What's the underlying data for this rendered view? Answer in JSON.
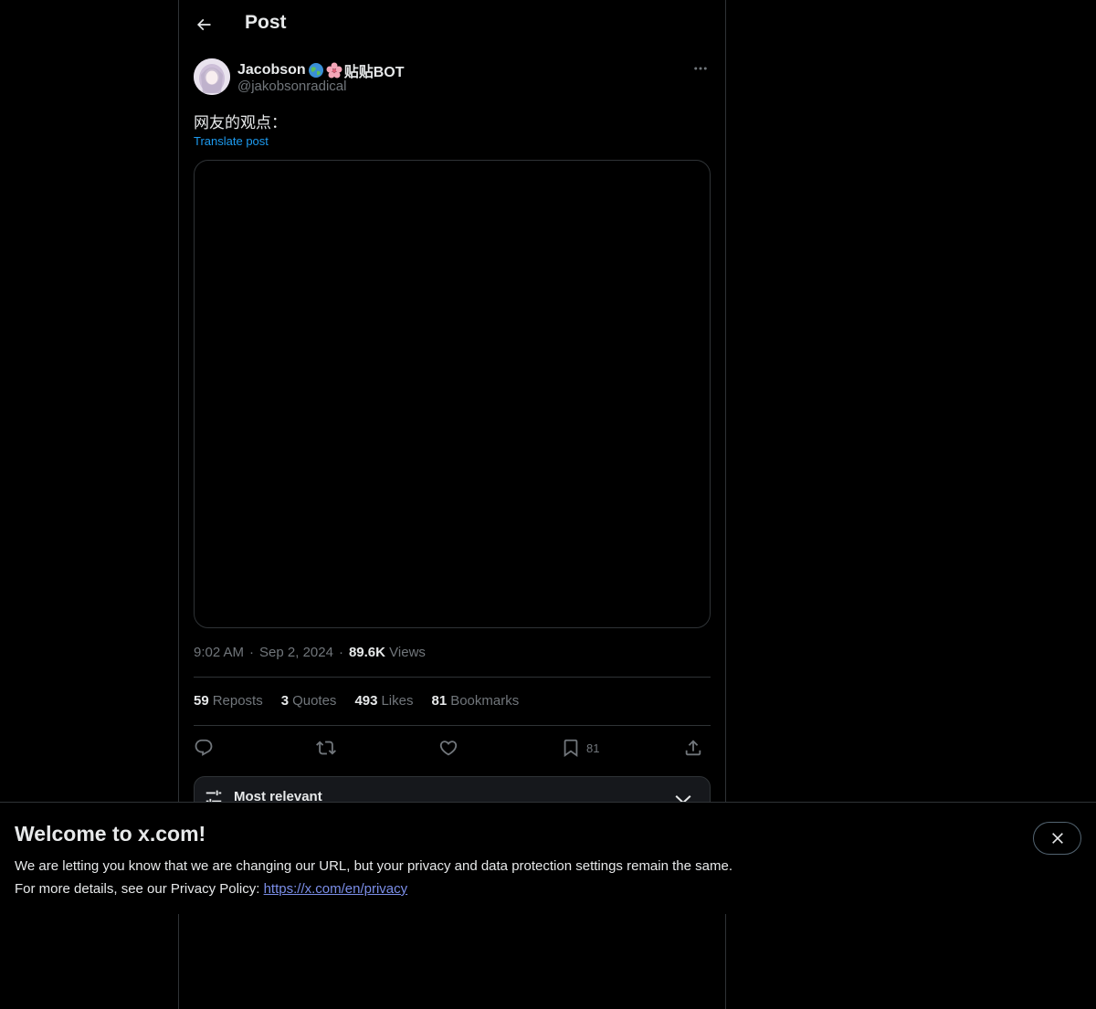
{
  "topbar": {
    "title": "Post"
  },
  "author": {
    "name": "Jacobson",
    "name_suffix": "贴贴BOT",
    "handle": "@jakobsonradical"
  },
  "post": {
    "text": "网友的观点：",
    "translate_label": "Translate post"
  },
  "meta": {
    "time": "9:02 AM",
    "date": "Sep 2, 2024",
    "views_count": "89.6K",
    "views_label": "Views"
  },
  "stats": {
    "reposts_count": "59",
    "reposts_label": "Reposts",
    "quotes_count": "3",
    "quotes_label": "Quotes",
    "likes_count": "493",
    "likes_label": "Likes",
    "bookmarks_count": "81",
    "bookmarks_label": "Bookmarks"
  },
  "actions": {
    "bookmark_count": "81"
  },
  "sort": {
    "label": "Most relevant"
  },
  "banner": {
    "title": "Welcome to x.com!",
    "line1": "We are letting you know that we are changing our URL, but your privacy and data protection settings remain the same.",
    "line2_prefix": "For more details, see our Privacy Policy: ",
    "link": "https://x.com/en/privacy"
  },
  "colors": {
    "accent": "#1d9bf0",
    "muted": "#71767b",
    "border": "#2f3336"
  },
  "icons": [
    "back-arrow-icon",
    "more-icon",
    "globe-emoji-icon",
    "flower-emoji-icon",
    "reply-icon",
    "repost-icon",
    "like-icon",
    "bookmark-icon",
    "share-icon",
    "sort-icon",
    "chevron-down-icon",
    "close-icon"
  ]
}
